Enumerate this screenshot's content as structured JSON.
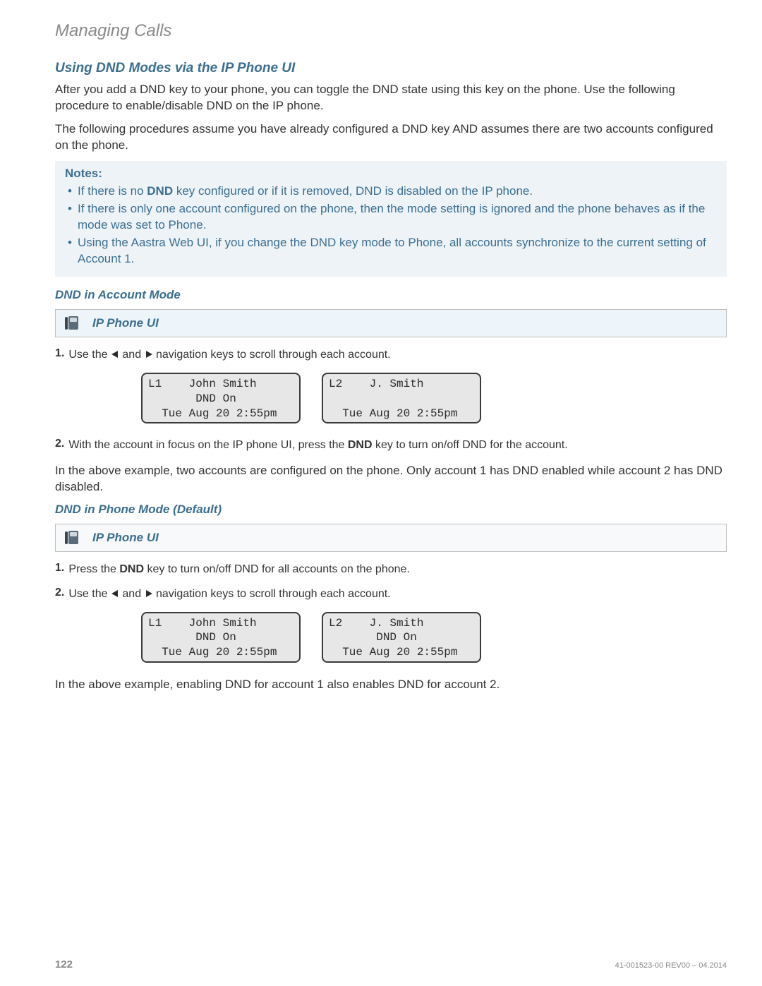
{
  "header": "Managing Calls",
  "section_title": "Using DND Modes via the IP Phone UI",
  "intro1": "After you add a DND key to your phone, you can toggle the DND state using this key on the phone. Use the following procedure to enable/disable DND on the IP phone.",
  "intro2": "The following procedures assume you have already configured a DND key AND assumes there are two accounts configured on the phone.",
  "notes_title": "Notes:",
  "notes": {
    "n1a": "If there is no ",
    "n1b": "DND",
    "n1c": " key configured or if it is removed, DND is disabled on the IP phone.",
    "n2": "If there is only one account configured on the phone, then the mode setting is ignored and the phone behaves as if the mode was set to Phone.",
    "n3": "Using the Aastra Web UI, if you change the DND key mode to Phone, all accounts synchronize to the current setting of Account 1."
  },
  "account_mode_title": "DND in Account Mode",
  "ui_bar_label": "IP Phone UI",
  "stepA1": {
    "num": "1.",
    "pre": "Use the ",
    "mid": " and ",
    "post": " navigation keys to scroll through each account."
  },
  "lcdA": {
    "left": "L1    John Smith\n       DND On\n  Tue Aug 20 2:55pm",
    "right": "L2    J. Smith\n\n  Tue Aug 20 2:55pm"
  },
  "stepA2": {
    "num": "2.",
    "pre": "With the account in focus on the IP phone UI, press the ",
    "key": "DND",
    "post": " key to turn on/off DND for the account."
  },
  "account_summary": "In the above example, two accounts are configured on the phone. Only account 1 has DND enabled while account 2 has DND disabled.",
  "phone_mode_title": "DND in Phone Mode (Default)",
  "stepB1": {
    "num": "1.",
    "pre": "Press the ",
    "key": "DND",
    "post": " key to turn on/off DND for all accounts on the phone."
  },
  "stepB2": {
    "num": "2.",
    "pre": "Use the ",
    "mid": " and ",
    "post": " navigation keys to scroll through each account."
  },
  "lcdB": {
    "left": "L1    John Smith\n       DND On\n  Tue Aug 20 2:55pm",
    "right": "L2    J. Smith\n       DND On\n  Tue Aug 20 2:55pm"
  },
  "phone_summary": "In the above example, enabling DND for account 1 also enables DND for account 2.",
  "footer": {
    "page": "122",
    "docid": "41-001523-00 REV00 – 04.2014"
  }
}
